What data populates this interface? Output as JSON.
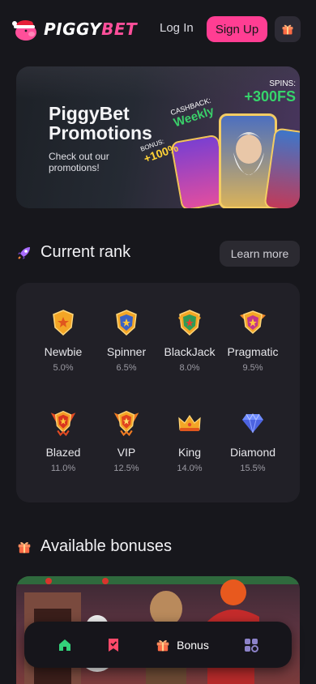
{
  "header": {
    "logo_left": "PIGGY",
    "logo_right": "BET",
    "login_label": "Log In",
    "signup_label": "Sign Up"
  },
  "promo": {
    "title": "PiggyBet\nPromotions",
    "subtitle": "Check out our promotions!",
    "cashback_small": "CASHBACK:",
    "cashback_big": "Weekly",
    "bonus_small": "BONUS:",
    "bonus_big": "+100%",
    "spins_small": "SPINS:",
    "spins_big": "+300FS"
  },
  "rank_section": {
    "title": "Current rank",
    "learn_more": "Learn more",
    "ranks": [
      {
        "name": "Newbie",
        "percent": "5.0%"
      },
      {
        "name": "Spinner",
        "percent": "6.5%"
      },
      {
        "name": "BlackJack",
        "percent": "8.0%"
      },
      {
        "name": "Pragmatic",
        "percent": "9.5%"
      },
      {
        "name": "Blazed",
        "percent": "11.0%"
      },
      {
        "name": "VIP",
        "percent": "12.5%"
      },
      {
        "name": "King",
        "percent": "14.0%"
      },
      {
        "name": "Diamond",
        "percent": "15.5%"
      }
    ]
  },
  "bonus_section": {
    "title": "Available bonuses"
  },
  "bottom_nav": {
    "bonus_label": "Bonus"
  },
  "colors": {
    "accent": "#ff3e93",
    "background": "#17171c",
    "card": "#212027",
    "home_active": "#33d17a"
  }
}
